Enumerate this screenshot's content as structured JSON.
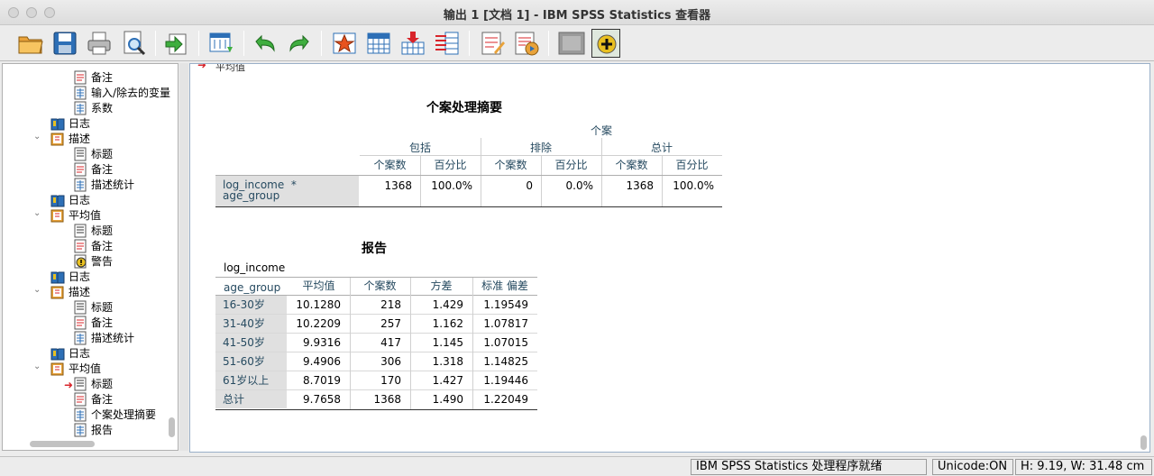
{
  "window": {
    "title": "输出 1 [文档 1] - IBM SPSS Statistics 查看器"
  },
  "toolbar": {
    "icons": [
      "open-icon",
      "save-icon",
      "print-icon",
      "print-preview-icon",
      "export-icon",
      "goto-data-icon",
      "undo-icon",
      "redo-icon",
      "goto-case-icon",
      "goto-variable-icon",
      "insert-cases-icon",
      "variables-icon",
      "edit-output-icon",
      "script-icon",
      "hide-icon",
      "insert-icon"
    ]
  },
  "outline": {
    "items": [
      {
        "label": "备注",
        "icon": "notes-icon"
      },
      {
        "label": "输入/除去的变量",
        "icon": "table-icon"
      },
      {
        "label": "系数",
        "icon": "table-icon"
      },
      {
        "label": "日志",
        "icon": "log-icon"
      },
      {
        "label": "描述",
        "icon": "procedure-icon"
      },
      {
        "label": "标题",
        "icon": "title-icon"
      },
      {
        "label": "备注",
        "icon": "notes-icon"
      },
      {
        "label": "描述统计",
        "icon": "table-icon"
      },
      {
        "label": "日志",
        "icon": "log-icon"
      },
      {
        "label": "平均值",
        "icon": "procedure-icon"
      },
      {
        "label": "标题",
        "icon": "title-icon"
      },
      {
        "label": "备注",
        "icon": "notes-icon"
      },
      {
        "label": "警告",
        "icon": "warning-icon"
      },
      {
        "label": "日志",
        "icon": "log-icon"
      },
      {
        "label": "描述",
        "icon": "procedure-icon"
      },
      {
        "label": "标题",
        "icon": "title-icon"
      },
      {
        "label": "备注",
        "icon": "notes-icon"
      },
      {
        "label": "描述统计",
        "icon": "table-icon"
      },
      {
        "label": "日志",
        "icon": "log-icon"
      },
      {
        "label": "平均值",
        "icon": "procedure-icon"
      },
      {
        "label": "标题",
        "icon": "title-icon"
      },
      {
        "label": "备注",
        "icon": "notes-icon"
      },
      {
        "label": "个案处理摘要",
        "icon": "table-icon"
      },
      {
        "label": "报告",
        "icon": "table-icon"
      }
    ]
  },
  "content": {
    "top_label": "平均值",
    "case_summary": {
      "title": "个案处理摘要",
      "group_header": "个案",
      "col_groups": [
        "包括",
        "排除",
        "总计"
      ],
      "sub_headers": [
        "个案数",
        "百分比",
        "个案数",
        "百分比",
        "个案数",
        "百分比"
      ],
      "row_label_1": "log_income  *",
      "row_label_2": "age_group",
      "values": [
        "1368",
        "100.0%",
        "0",
        "0.0%",
        "1368",
        "100.0%"
      ]
    },
    "report": {
      "title": "报告",
      "dep_var": "log_income",
      "row_var": "age_group",
      "headers": [
        "平均值",
        "个案数",
        "方差",
        "标准 偏差"
      ],
      "rows": [
        {
          "label": "16-30岁",
          "values": [
            "10.1280",
            "218",
            "1.429",
            "1.19549"
          ]
        },
        {
          "label": "31-40岁",
          "values": [
            "10.2209",
            "257",
            "1.162",
            "1.07817"
          ]
        },
        {
          "label": "41-50岁",
          "values": [
            "9.9316",
            "417",
            "1.145",
            "1.07015"
          ]
        },
        {
          "label": "51-60岁",
          "values": [
            "9.4906",
            "306",
            "1.318",
            "1.14825"
          ]
        },
        {
          "label": "61岁以上",
          "values": [
            "8.7019",
            "170",
            "1.427",
            "1.19446"
          ]
        },
        {
          "label": "总计",
          "values": [
            "9.7658",
            "1368",
            "1.490",
            "1.22049"
          ]
        }
      ]
    }
  },
  "status": {
    "processor": "IBM SPSS Statistics 处理程序就绪",
    "unicode": "Unicode:ON",
    "dims": "H: 9.19, W: 31.48 cm"
  }
}
